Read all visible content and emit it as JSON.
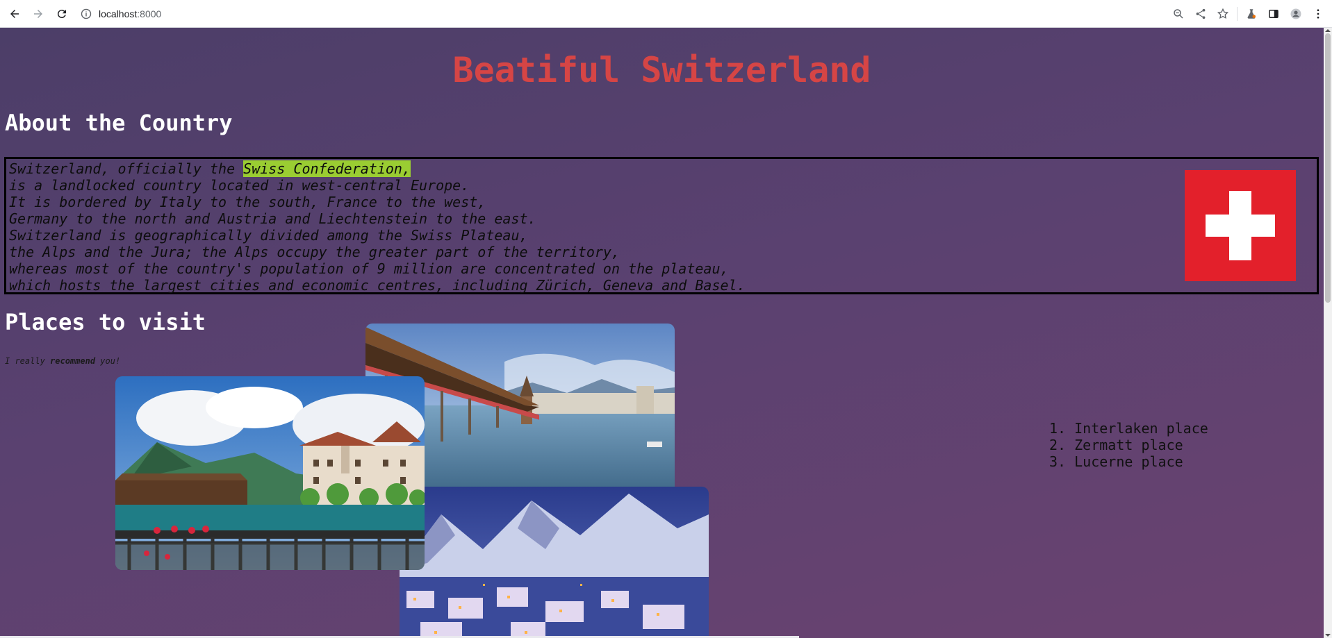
{
  "browser": {
    "url_host": "localhost",
    "url_port": ":8000",
    "icons": [
      "back-arrow-icon",
      "forward-arrow-icon",
      "reload-icon",
      "site-info-icon",
      "zoom-icon",
      "share-icon",
      "bookmark-star-icon",
      "extensions-flask-icon",
      "side-panel-icon",
      "profile-avatar-icon",
      "menu-kebab-icon"
    ]
  },
  "page": {
    "title": "Beatiful Switzerland",
    "about_heading": "About the Country",
    "about": {
      "line1_before": "Switzerland, officially the ",
      "line1_highlight": "Swiss Confederation,",
      "lines": [
        "is a landlocked country located in west-central Europe.",
        "It is bordered by Italy to the south, France to the west,",
        "Germany to the north and Austria and Liechtenstein to the east.",
        "Switzerland is geographically divided among the Swiss Plateau,",
        "the Alps and the Jura; the Alps occupy the greater part of the territory,",
        "whereas most of the country's population of 9 million are concentrated on the plateau,",
        "which hosts the largest cities and economic centres, including Zürich, Geneva and Basel."
      ],
      "highlight_color": "#9acd32"
    },
    "places_heading": "Places to visit",
    "note": {
      "before": "I really ",
      "bold": "recommend",
      "after": " you!"
    },
    "places": [
      "1. Interlaken place",
      "2. Zermatt place",
      "3. Lucerne place"
    ],
    "photos": [
      "Lucerne chapel bridge photo",
      "Interlaken lakeside photo",
      "Zermatt night village photo"
    ],
    "colors": {
      "title": "#d64545",
      "flag_red": "#e3202b",
      "background": "#4a3d68"
    }
  }
}
